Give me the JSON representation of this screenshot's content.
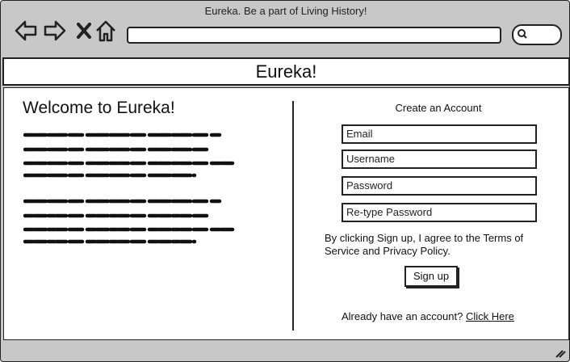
{
  "browser": {
    "title": "Eureka. Be a part of Living History!",
    "back_icon": "back-arrow-icon",
    "forward_icon": "forward-arrow-icon",
    "stop_icon": "close-icon",
    "home_icon": "home-icon",
    "url": "",
    "search_icon": "search-icon"
  },
  "site": {
    "name": "Eureka!"
  },
  "intro": {
    "heading": "Welcome to Eureka!"
  },
  "form": {
    "heading": "Create an Account",
    "fields": [
      {
        "placeholder": "Email"
      },
      {
        "placeholder": "Username"
      },
      {
        "placeholder": "Password"
      },
      {
        "placeholder": "Re-type Password"
      }
    ],
    "terms": "By clicking Sign up, I agree to the Terms of Service and Privacy Policy.",
    "submit_label": "Sign up",
    "login_prompt": "Already have an account?",
    "login_link": "Click Here"
  }
}
